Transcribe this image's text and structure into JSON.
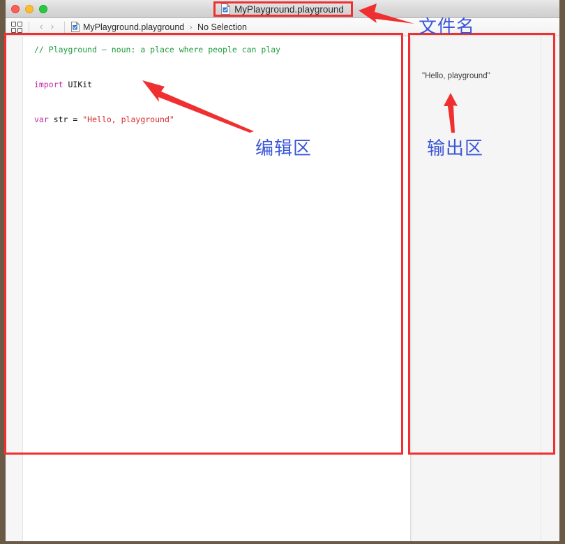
{
  "window": {
    "title": "MyPlayground.playground",
    "controls": [
      {
        "name": "close",
        "color": "#ff5f57"
      },
      {
        "name": "minimize",
        "color": "#ffbd2e"
      },
      {
        "name": "zoom",
        "color": "#28c840"
      }
    ]
  },
  "toolbar": {
    "grid_icon": "grid-icon",
    "back_glyph": "‹",
    "forward_glyph": "›",
    "breadcrumb": {
      "file": "MyPlayground.playground",
      "separator": "›",
      "selection": "No Selection"
    }
  },
  "editor": {
    "lines": [
      {
        "id": "line-comment",
        "tokens": [
          {
            "cls": "c-comment",
            "text": "// Playground — noun: a place where people can play"
          }
        ]
      },
      {
        "id": "line-blank-1",
        "tokens": [
          {
            "cls": "c-plain",
            "text": " "
          }
        ]
      },
      {
        "id": "line-import",
        "tokens": [
          {
            "cls": "c-kw",
            "text": "import"
          },
          {
            "cls": "c-plain",
            "text": " UIKit"
          }
        ]
      },
      {
        "id": "line-blank-2",
        "tokens": [
          {
            "cls": "c-plain",
            "text": " "
          }
        ]
      },
      {
        "id": "line-var",
        "tokens": [
          {
            "cls": "c-kw",
            "text": "var"
          },
          {
            "cls": "c-plain",
            "text": " str = "
          },
          {
            "cls": "c-str",
            "text": "\"Hello, playground\""
          }
        ]
      }
    ]
  },
  "output": {
    "lines": [
      "\"Hello, playground\""
    ]
  },
  "annotations": {
    "accent_color": "#f03030",
    "label_color": "#3a55d8",
    "labels": {
      "filename": "文件名",
      "editor_area": "编辑区",
      "output_area": "输出区"
    },
    "boxes": [
      {
        "name": "title-highlight"
      },
      {
        "name": "editor-highlight"
      },
      {
        "name": "output-highlight"
      }
    ],
    "arrows": [
      {
        "name": "arrow-to-title"
      },
      {
        "name": "arrow-to-editor"
      },
      {
        "name": "arrow-to-output"
      }
    ]
  }
}
